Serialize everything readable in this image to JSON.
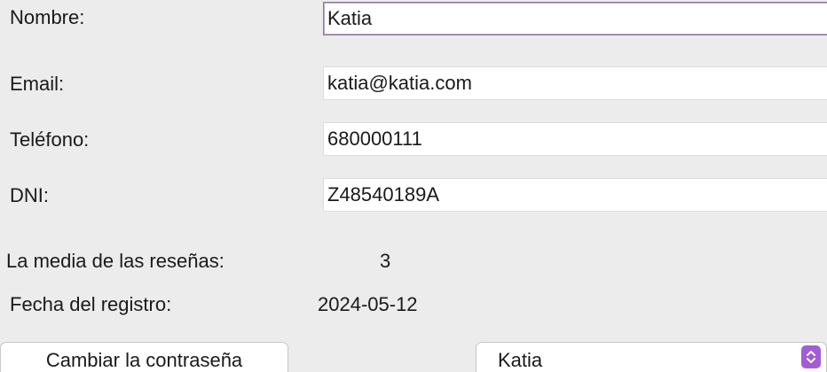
{
  "form": {
    "name_label": "Nombre:",
    "name_value": "Katia",
    "email_label": "Email:",
    "email_value": "katia@katia.com",
    "phone_label": "Teléfono:",
    "phone_value": "680000111",
    "dni_label": "DNI:",
    "dni_value": "Z48540189A",
    "rating_label": "La media de las reseñas:",
    "rating_value": "3",
    "registered_label": "Fecha del registro:",
    "registered_value": "2024-05-12"
  },
  "actions": {
    "change_password_label": "Cambiar la contraseña",
    "user_select_value": "Katia",
    "select_icon": "up-down-chevron-icon"
  },
  "colors": {
    "accent": "#a35bd6",
    "background": "#ececec"
  }
}
